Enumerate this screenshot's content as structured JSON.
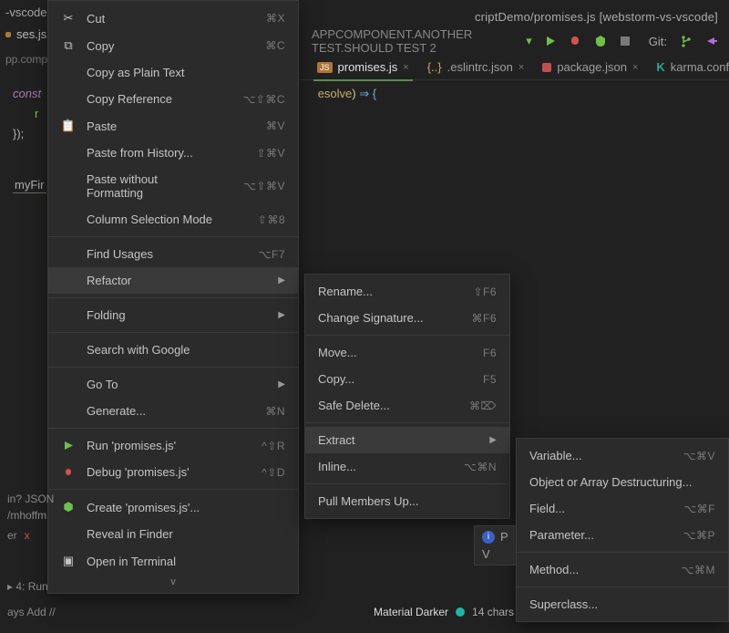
{
  "window": {
    "title_fragment": "criptDemo/promises.js [webstorm-vs-vscode]",
    "project_tag": "-vscode"
  },
  "toolbar_icons": [
    "run",
    "debug",
    "coverage",
    "stop"
  ],
  "git": {
    "label": "Git:"
  },
  "run_config": {
    "label": "APPCOMPONENT.ANOTHER TEST.SHOULD TEST 2",
    "chevron": "▾"
  },
  "left_tab": {
    "label": "ses.js",
    "dirty": true
  },
  "breadcrumb": {
    "prefix": "pp.compone",
    "suffix": ""
  },
  "tabs": [
    {
      "label": "promises.js",
      "icon": "js",
      "active": true,
      "closeable": true
    },
    {
      "label": ".eslintrc.json",
      "icon": "braces",
      "active": false,
      "closeable": true
    },
    {
      "label": "package.json",
      "icon": "json-red",
      "active": false,
      "closeable": true
    },
    {
      "label": "karma.conf.js",
      "icon": "k",
      "active": false,
      "closeable": true
    }
  ],
  "code": {
    "line1_kw": "const",
    "line1_rest": "",
    "line1_fn": "esolve",
    "line1_paren": ")",
    "line1_arrow": " ⇒ {",
    "line2_prefix": "r",
    "line3": "});",
    "symbol": "myFir"
  },
  "menu_main": {
    "items": [
      {
        "icon": "scissors",
        "label": "Cut",
        "shortcut": "⌘X"
      },
      {
        "icon": "copy",
        "label": "Copy",
        "shortcut": "⌘C"
      },
      {
        "label": "Copy as Plain Text"
      },
      {
        "label": "Copy Reference",
        "shortcut": "⌥⇧⌘C"
      },
      {
        "icon": "paste",
        "label": "Paste",
        "shortcut": "⌘V"
      },
      {
        "label": "Paste from History...",
        "shortcut": "⇧⌘V"
      },
      {
        "label": "Paste without Formatting",
        "shortcut": "⌥⇧⌘V"
      },
      {
        "label": "Column Selection Mode",
        "shortcut": "⇧⌘8"
      },
      {
        "sep": true
      },
      {
        "label": "Find Usages",
        "shortcut": "⌥F7"
      },
      {
        "label": "Refactor",
        "submenu": true,
        "highlight": true
      },
      {
        "sep": true
      },
      {
        "label": "Folding",
        "submenu": true
      },
      {
        "sep": true
      },
      {
        "label": "Search with Google"
      },
      {
        "sep": true
      },
      {
        "label": "Go To",
        "submenu": true
      },
      {
        "label": "Generate...",
        "shortcut": "⌘N"
      },
      {
        "sep": true
      },
      {
        "icon": "run-green",
        "label": "Run 'promises.js'",
        "shortcut": "^⇧R"
      },
      {
        "icon": "bug-red",
        "label": "Debug 'promises.js'",
        "shortcut": "^⇧D"
      },
      {
        "sep": true
      },
      {
        "icon": "hex-green",
        "label": "Create 'promises.js'..."
      },
      {
        "label": "Reveal in Finder"
      },
      {
        "icon": "terminal",
        "label": "Open in Terminal"
      }
    ],
    "scroll": "v"
  },
  "menu_refactor": {
    "items": [
      {
        "label": "Rename...",
        "shortcut": "⇧F6"
      },
      {
        "label": "Change Signature...",
        "shortcut": "⌘F6"
      },
      {
        "sep": true
      },
      {
        "label": "Move...",
        "shortcut": "F6"
      },
      {
        "label": "Copy...",
        "shortcut": "F5"
      },
      {
        "label": "Safe Delete...",
        "shortcut": "⌘⌦"
      },
      {
        "sep": true
      },
      {
        "label": "Extract",
        "submenu": true,
        "highlight": true
      },
      {
        "label": "Inline...",
        "shortcut": "⌥⌘N"
      },
      {
        "sep": true
      },
      {
        "label": "Pull Members Up..."
      }
    ]
  },
  "menu_extract": {
    "items": [
      {
        "label": "Variable...",
        "shortcut": "⌥⌘V"
      },
      {
        "label": "Object or Array Destructuring..."
      },
      {
        "label": "Field...",
        "shortcut": "⌥⌘F"
      },
      {
        "label": "Parameter...",
        "shortcut": "⌥⌘P"
      },
      {
        "sep": true
      },
      {
        "label": "Method...",
        "shortcut": "⌥⌘M"
      },
      {
        "sep": true
      },
      {
        "label": "Superclass..."
      }
    ]
  },
  "terminal": {
    "line1": "in? JSON",
    "line2_prefix": "/mhoffm",
    "error_line": "er ",
    "error_mark": "x"
  },
  "run_tool": {
    "label": "▸ 4: Run"
  },
  "vcs": {
    "label": "ays Add //"
  },
  "status": {
    "theme": "Material Darker",
    "chars": "14 chars"
  },
  "popup_fragment": {
    "p": "P",
    "v": "V"
  }
}
